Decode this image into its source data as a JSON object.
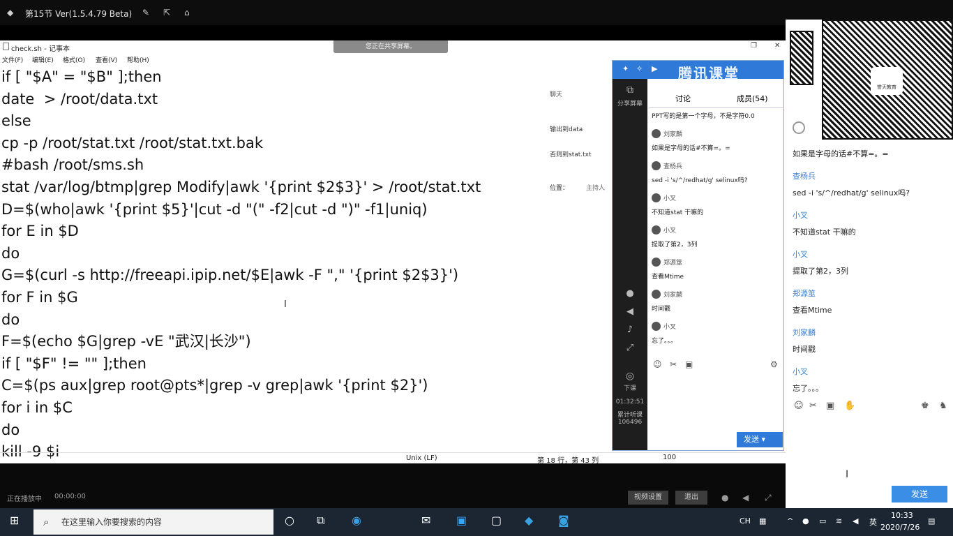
{
  "player_title": "第15节 Ver(1.5.4.79 Beta)",
  "notepad": {
    "title": "check.sh - 记事本",
    "menu": [
      "文件(F)",
      "编辑(E)",
      "格式(O)",
      "查看(V)",
      "帮助(H)"
    ],
    "share_banner": "您正在共享屏幕。",
    "lines": [
      "if [ \"$A\" = \"$B\" ];then",
      "date  > /root/data.txt",
      "else",
      "cp -p /root/stat.txt /root/stat.txt.bak",
      "#bash /root/sms.sh",
      "stat /var/log/btmp|grep Modify|awk '{print $2$3}' > /root/stat.txt",
      "D=$(who|awk '{print $5}'|cut -d \"(\" -f2|cut -d \")\" -f1|uniq)",
      "for E in $D",
      "do",
      "G=$(curl -s http://freeapi.ipip.net/$E|awk -F \",\" '{print $2$3}')",
      "for F in $G",
      "do",
      "F=$(echo $G|grep -vE \"武汉|长沙\")",
      "if [ \"$F\" != \"\" ];then",
      "C=$(ps aux|grep root@pts*|grep -v grep|awk '{print $2}')",
      "for i in $C",
      "do",
      "kill -9 $i"
    ],
    "status_encoding": "Unix (LF)",
    "status_position": "第 18 行，第 43 列",
    "status_zoom": "100"
  },
  "chat_bg": {
    "title": "聊天",
    "lines": [
      "输出到data",
      "否则到stat.txt"
    ],
    "position_label": "位置：",
    "host_label": "主持人"
  },
  "tencent": {
    "brand": "腾讯课堂",
    "tab_discuss": "讨论",
    "tab_members": "成员(54)",
    "side": {
      "share": "分享屏幕",
      "down": "下课",
      "time": "01:32:51",
      "stats": "累计听课 106496"
    },
    "messages": [
      {
        "type": "text",
        "text": "PPT写的是第一个字母，不是字符0.0"
      },
      {
        "type": "name",
        "text": "刘家麟"
      },
      {
        "type": "text",
        "text": "如果是字母的话#不算=。="
      },
      {
        "type": "name",
        "text": "查杨兵"
      },
      {
        "type": "text",
        "text": "sed -i 's/^/redhat/g' selinux吗?"
      },
      {
        "type": "name",
        "text": "小叉"
      },
      {
        "type": "text",
        "text": "不知道stat 干嘛的"
      },
      {
        "type": "name",
        "text": "小叉"
      },
      {
        "type": "text",
        "text": "提取了第2，3列"
      },
      {
        "type": "name",
        "text": "郑源筮"
      },
      {
        "type": "text",
        "text": "查看Mtime"
      },
      {
        "type": "name",
        "text": "刘家麟"
      },
      {
        "type": "text",
        "text": "时间戳"
      },
      {
        "type": "name",
        "text": "小叉"
      },
      {
        "type": "text",
        "text": "忘了。。。"
      }
    ],
    "send": "发送"
  },
  "right_panel": {
    "logo_text": "誉天教育",
    "messages": [
      {
        "type": "text",
        "text": "如果是字母的话#不算=。="
      },
      {
        "type": "name",
        "text": "查杨兵"
      },
      {
        "type": "text",
        "text": "sed -i 's/^/redhat/g' selinux吗?"
      },
      {
        "type": "name",
        "text": "小叉"
      },
      {
        "type": "text",
        "text": "不知道stat 干嘛的"
      },
      {
        "type": "name",
        "text": "小叉"
      },
      {
        "type": "text",
        "text": "提取了第2，3列"
      },
      {
        "type": "name",
        "text": "郑源筮"
      },
      {
        "type": "text",
        "text": "查看Mtime"
      },
      {
        "type": "name",
        "text": "刘家麟"
      },
      {
        "type": "text",
        "text": "时间戳"
      },
      {
        "type": "name",
        "text": "小叉"
      },
      {
        "type": "text",
        "text": "忘了。。。"
      }
    ],
    "send": "发送"
  },
  "player": {
    "label": "正在播放中",
    "time": "00:00:00",
    "btn_settings": "视频设置",
    "btn_quit": "退出"
  },
  "taskbar": {
    "search_placeholder": "在这里输入你要搜索的内容",
    "lang": "CH",
    "time": "10:33",
    "date": "2020/7/26"
  }
}
